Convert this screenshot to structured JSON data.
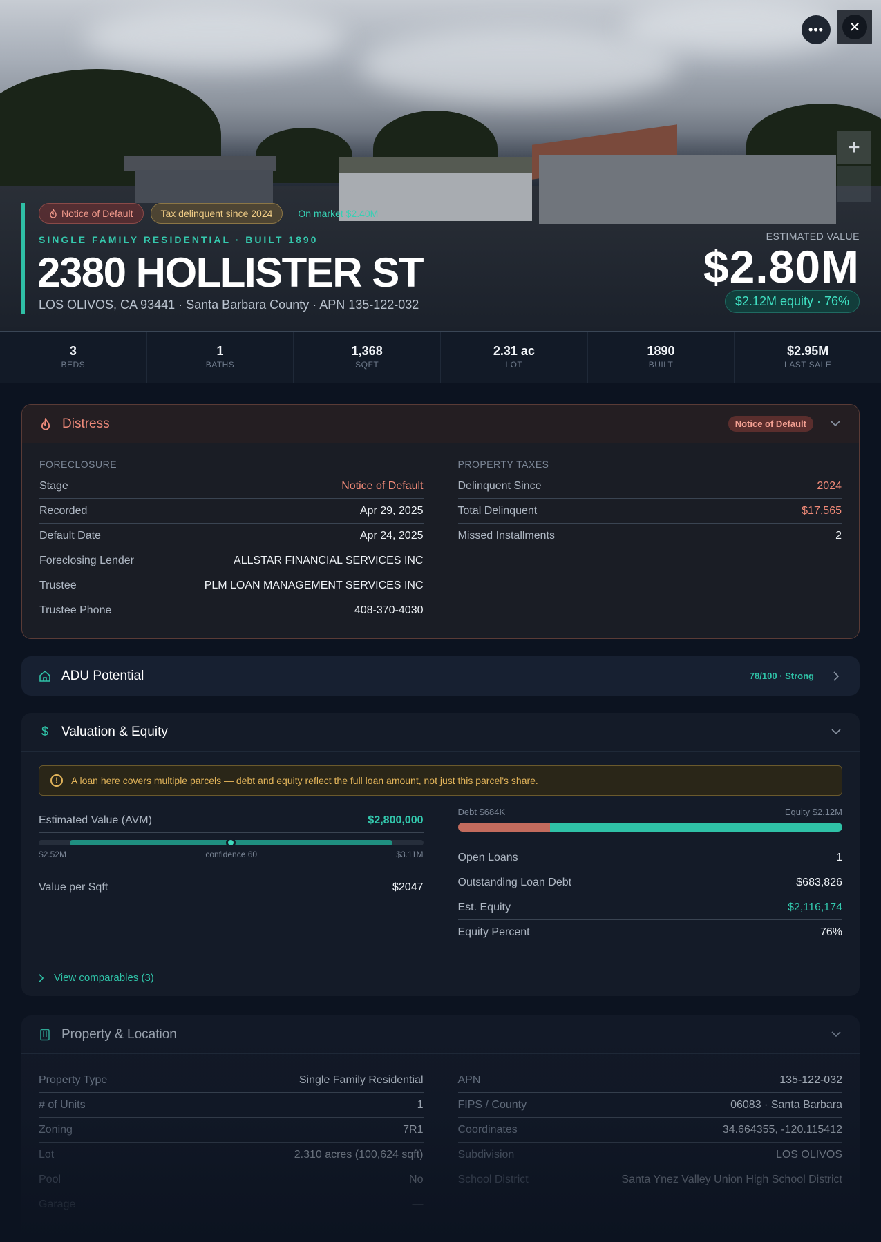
{
  "hero": {
    "chips": [
      {
        "label": "Notice of Default",
        "icon": "flame-icon"
      },
      {
        "label": "Tax delinquent since 2024"
      },
      {
        "label": "On market $2.40M"
      }
    ],
    "subtitle": "SINGLE FAMILY RESIDENTIAL · BUILT 1890",
    "title": "2380 HOLLISTER ST",
    "address_line": "LOS OLIVOS, CA 93441 · Santa Barbara County · APN 135-122-032",
    "estimated_label": "ESTIMATED VALUE",
    "estimated_value": "$2.80M",
    "equity_pill": "$2.12M equity · 76%",
    "more_glyph": "•••",
    "close_glyph": "✕",
    "zoom_in_glyph": "+"
  },
  "stats": [
    {
      "value": "3",
      "label": "BEDS"
    },
    {
      "value": "1",
      "label": "BATHS"
    },
    {
      "value": "1,368",
      "label": "SQFT"
    },
    {
      "value": "2.31 ac",
      "label": "LOT"
    },
    {
      "value": "1890",
      "label": "BUILT"
    },
    {
      "value": "$2.95M",
      "label": "LAST SALE"
    }
  ],
  "distress": {
    "title": "Distress",
    "badge": "Notice of Default",
    "foreclosure": {
      "label": "FORECLOSURE",
      "rows": [
        {
          "k": "Stage",
          "v": "Notice of Default"
        },
        {
          "k": "Recorded",
          "v": "Apr 29, 2025"
        },
        {
          "k": "Default Date",
          "v": "Apr 24, 2025"
        },
        {
          "k": "Foreclosing Lender",
          "v": "ALLSTAR FINANCIAL SERVICES INC"
        },
        {
          "k": "Trustee",
          "v": "PLM LOAN MANAGEMENT SERVICES INC"
        },
        {
          "k": "Trustee Phone",
          "v": "408-370-4030"
        }
      ]
    },
    "taxes": {
      "label": "PROPERTY TAXES",
      "rows": [
        {
          "k": "Delinquent Since",
          "v": "2024"
        },
        {
          "k": "Total Delinquent",
          "v": "$17,565"
        },
        {
          "k": "Missed Installments",
          "v": "2"
        }
      ]
    }
  },
  "adu": {
    "title": "ADU Potential",
    "score": "78/100 · Strong"
  },
  "valuation": {
    "title": "Valuation & Equity",
    "notice": "A loan here covers multiple parcels — debt and equity reflect the full loan amount, not just this parcel's share.",
    "avm_label": "Estimated Value (AVM)",
    "avm_value": "$2,800,000",
    "range_low": "$2.52M",
    "range_confidence": "confidence 60",
    "range_high": "$3.11M",
    "range_position": 0.5,
    "value_per_sqft_label": "Value per Sqft",
    "value_per_sqft": "$2047",
    "debt_label": "Debt $684K",
    "equity_label": "Equity $2.12M",
    "debt_fraction": 0.24,
    "rows": [
      {
        "k": "Open Loans",
        "v": "1"
      },
      {
        "k": "Outstanding Loan Debt",
        "v": "$683,826"
      },
      {
        "k": "Est. Equity",
        "v": "$2,116,174"
      },
      {
        "k": "Equity Percent",
        "v": "76%"
      }
    ],
    "comparables": "View comparables (3)"
  },
  "property": {
    "title": "Property & Location",
    "left_rows": [
      {
        "k": "Property Type",
        "v": "Single Family Residential"
      },
      {
        "k": "# of Units",
        "v": "1"
      },
      {
        "k": "Zoning",
        "v": "7R1"
      },
      {
        "k": "Lot",
        "v": "2.310 acres (100,624 sqft)"
      },
      {
        "k": "Pool",
        "v": "No"
      },
      {
        "k": "Garage",
        "v": "—"
      }
    ],
    "right_rows": [
      {
        "k": "APN",
        "v": "135-122-032"
      },
      {
        "k": "FIPS / County",
        "v": "06083 · Santa Barbara"
      },
      {
        "k": "Coordinates",
        "v": "34.664355, -120.115412"
      },
      {
        "k": "Subdivision",
        "v": "LOS OLIVOS"
      },
      {
        "k": "School District",
        "v": "Santa Ynez Valley Union High School District"
      }
    ]
  },
  "colors": {
    "accent": "#2fc2a7",
    "distress": "#ef8a7a",
    "warning": "#e2b45a",
    "background": "#0c1320"
  }
}
